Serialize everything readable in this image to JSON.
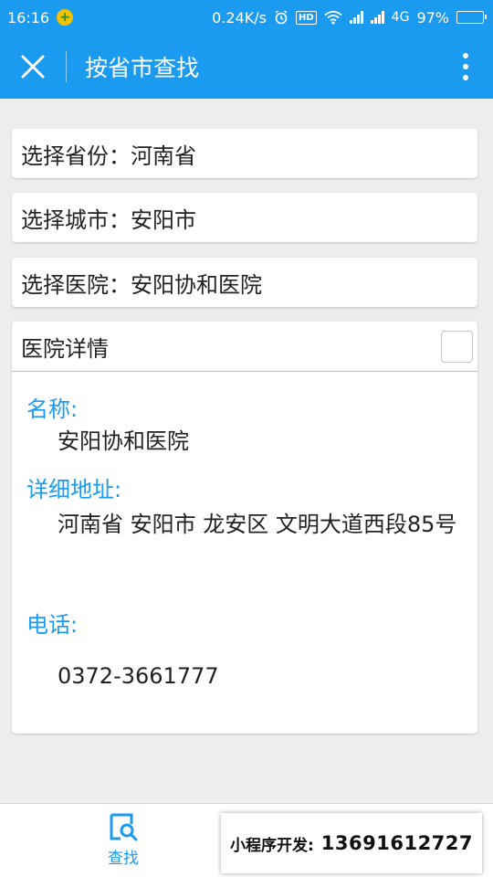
{
  "status_bar": {
    "time": "16:16",
    "network_speed": "0.24K/s",
    "hd_label": "HD",
    "network_type": "4G",
    "battery": "97%",
    "battery_level": 97
  },
  "nav": {
    "title": "按省市查找"
  },
  "selects": {
    "province": "选择省份：河南省",
    "city": "选择城市：安阳市",
    "hospital": "选择医院：安阳协和医院"
  },
  "detail": {
    "header": "医院详情",
    "name_label": "名称:",
    "name_value": "安阳协和医院",
    "address_label": "详细地址:",
    "address_value": " 河南省 安阳市 龙安区 文明大道西段85号",
    "phone_label": "电话:",
    "phone_value": "0372-3661777"
  },
  "tab_bar": {
    "search_label": "查找"
  },
  "watermark": {
    "prefix": "小程序开发:",
    "phone": "13691612727"
  },
  "colors": {
    "primary": "#1a9bef",
    "background": "#ededed"
  }
}
